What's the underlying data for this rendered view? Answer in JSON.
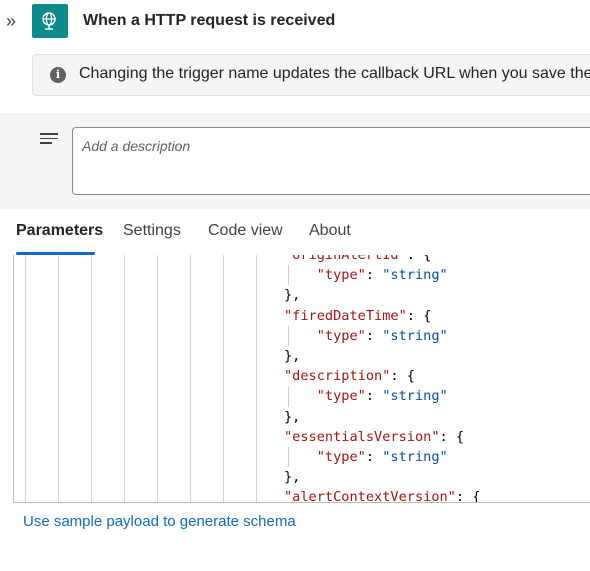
{
  "header": {
    "collapse_glyph": "»",
    "title": "When a HTTP request is received",
    "trigger_icon": "globe-icon",
    "trigger_color": "#0f8a8a"
  },
  "info": {
    "icon": "info-icon",
    "text": "Changing the trigger name updates the callback URL when you save the workflow."
  },
  "description": {
    "icon": "lines-icon",
    "placeholder": "Add a description"
  },
  "tabs": [
    {
      "label": "Parameters",
      "active": true
    },
    {
      "label": "Settings",
      "active": false
    },
    {
      "label": "Code view",
      "active": false
    },
    {
      "label": "About",
      "active": false
    }
  ],
  "schema_lines": [
    {
      "indent": 0,
      "parts": [
        [
          "k",
          "\"originAlertId\""
        ],
        [
          "p",
          ": {"
        ]
      ]
    },
    {
      "indent": 1,
      "parts": [
        [
          "k",
          "\"type\""
        ],
        [
          "p",
          ": "
        ],
        [
          "s",
          "\"string\""
        ]
      ]
    },
    {
      "indent": 0,
      "parts": [
        [
          "p",
          "},"
        ]
      ]
    },
    {
      "indent": 0,
      "parts": [
        [
          "k",
          "\"firedDateTime\""
        ],
        [
          "p",
          ": {"
        ]
      ]
    },
    {
      "indent": 1,
      "parts": [
        [
          "k",
          "\"type\""
        ],
        [
          "p",
          ": "
        ],
        [
          "s",
          "\"string\""
        ]
      ]
    },
    {
      "indent": 0,
      "parts": [
        [
          "p",
          "},"
        ]
      ]
    },
    {
      "indent": 0,
      "parts": [
        [
          "k",
          "\"description\""
        ],
        [
          "p",
          ": {"
        ]
      ]
    },
    {
      "indent": 1,
      "parts": [
        [
          "k",
          "\"type\""
        ],
        [
          "p",
          ": "
        ],
        [
          "s",
          "\"string\""
        ]
      ]
    },
    {
      "indent": 0,
      "parts": [
        [
          "p",
          "},"
        ]
      ]
    },
    {
      "indent": 0,
      "parts": [
        [
          "k",
          "\"essentialsVersion\""
        ],
        [
          "p",
          ": {"
        ]
      ]
    },
    {
      "indent": 1,
      "parts": [
        [
          "k",
          "\"type\""
        ],
        [
          "p",
          ": "
        ],
        [
          "s",
          "\"string\""
        ]
      ]
    },
    {
      "indent": 0,
      "parts": [
        [
          "p",
          "},"
        ]
      ]
    },
    {
      "indent": 0,
      "parts": [
        [
          "k",
          "\"alertContextVersion\""
        ],
        [
          "p",
          ": {"
        ]
      ]
    }
  ],
  "link": {
    "label": "Use sample payload to generate schema"
  },
  "colors": {
    "accent": "#0f6cbd",
    "json_key": "#a31515",
    "json_string": "#0451a5"
  }
}
